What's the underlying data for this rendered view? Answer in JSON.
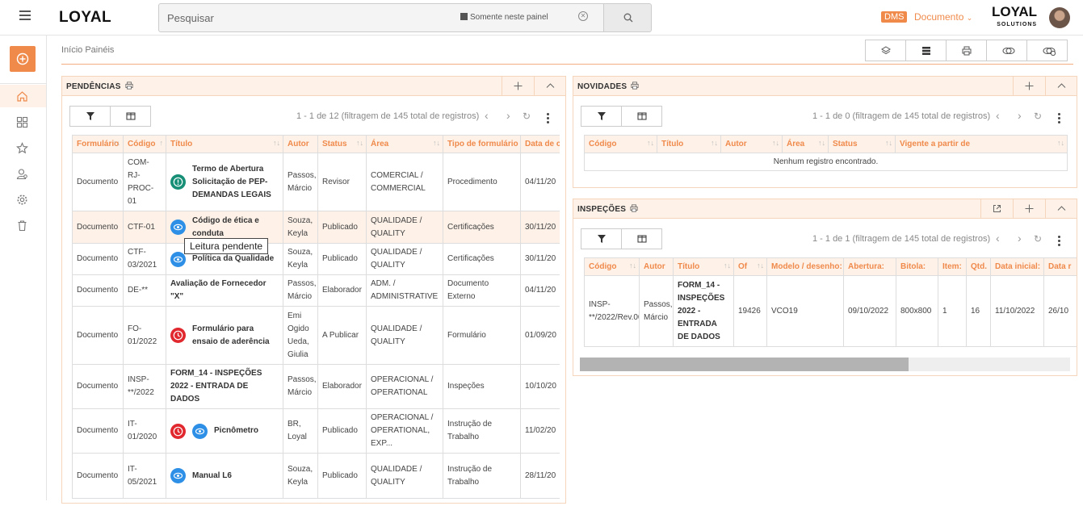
{
  "header": {
    "logo": "LOYAL",
    "search_placeholder": "Pesquisar",
    "only_panel_label": "Somente neste painel",
    "dms_badge": "DMS",
    "module_label": "Documento",
    "brand": "LOYAL",
    "brand_sub": "SOLUTIONS"
  },
  "sidebar": {
    "items": [
      "home-icon",
      "dashboard-grid-icon",
      "star-icon",
      "user-search-icon",
      "gear-icon",
      "trash-icon"
    ]
  },
  "breadcrumb": "Início Painéis",
  "pendencias": {
    "title": "PENDÊNCIAS",
    "paging": "1 - 1 de 12 (filtragem de 145 total de registros)",
    "columns": [
      "Formulário",
      "Código",
      "Título",
      "Autor",
      "Status",
      "Área",
      "Tipo de formulário",
      "Data de cr"
    ],
    "rows": [
      {
        "form": "Documento",
        "code": "COM-RJ-PROC-01",
        "title": "Termo de Abertura Solicitação de PEP-DEMANDAS LEGAIS",
        "author": "Passos, Márcio",
        "status": "Revisor",
        "area": "COMERCIAL / COMMERCIAL",
        "type": "Procedimento",
        "date": "04/11/20"
      },
      {
        "form": "Documento",
        "code": "CTF-01",
        "title": "Código de ética e conduta",
        "author": "Souza, Keyla",
        "status": "Publicado",
        "area": "QUALIDADE / QUALITY",
        "type": "Certificações",
        "date": "30/11/20"
      },
      {
        "form": "Documento",
        "code": "CTF-03/2021",
        "title": "Política da Qualidade",
        "author": "Souza, Keyla",
        "status": "Publicado",
        "area": "QUALIDADE / QUALITY",
        "type": "Certificações",
        "date": "30/11/20"
      },
      {
        "form": "Documento",
        "code": "DE-**",
        "title": "Avaliação de Fornecedor \"X\"",
        "author": "Passos, Márcio",
        "status": "Elaborador",
        "area": "ADM. / ADMINISTRATIVE",
        "type": "Documento Externo",
        "date": "04/11/20"
      },
      {
        "form": "Documento",
        "code": "FO-01/2022",
        "title": "Formulário para ensaio de aderência",
        "author": "Emi Ogido Ueda, Giulia",
        "status": "A Publicar",
        "area": "QUALIDADE / QUALITY",
        "type": "Formulário",
        "date": "01/09/20"
      },
      {
        "form": "Documento",
        "code": "INSP-**/2022",
        "title": "FORM_14 - INSPEÇÕES 2022 - ENTRADA DE DADOS",
        "author": "Passos, Márcio",
        "status": "Elaborador",
        "area": "OPERACIONAL / OPERATIONAL",
        "type": "Inspeções",
        "date": "10/10/20"
      },
      {
        "form": "Documento",
        "code": "IT-01/2020",
        "title": "Picnômetro",
        "author": "BR, Loyal",
        "status": "Publicado",
        "area": "OPERACIONAL / OPERATIONAL, EXP...",
        "type": "Instrução de Trabalho",
        "date": "11/02/20"
      },
      {
        "form": "Documento",
        "code": "IT-05/2021",
        "title": "Manual L6",
        "author": "Souza, Keyla",
        "status": "Publicado",
        "area": "QUALIDADE / QUALITY",
        "type": "Instrução de Trabalho",
        "date": "28/11/20"
      }
    ],
    "tooltip": "Leitura pendente"
  },
  "novidades": {
    "title": "NOVIDADES",
    "paging": "1 - 1 de 0 (filtragem de 145 total de registros)",
    "columns": [
      "Código",
      "Título",
      "Autor",
      "Área",
      "Status",
      "Vigente a partir de"
    ],
    "empty": "Nenhum registro encontrado."
  },
  "inspecoes": {
    "title": "INSPEÇÕES",
    "paging": "1 - 1 de 1 (filtragem de 145 total de registros)",
    "columns": [
      "Código",
      "Autor",
      "Título",
      "Of",
      "Modelo / desenho:",
      "Abertura:",
      "Bitola:",
      "Item:",
      "Qtd.",
      "Data inicial:",
      "Data r"
    ],
    "row": {
      "code": "INSP-**/2022/Rev.00",
      "author": "Passos, Márcio",
      "title": "FORM_14 - INSPEÇÕES 2022 - ENTRADA DE DADOS",
      "of": "19426",
      "model": "VCO19",
      "opening": "09/10/2022",
      "gauge": "800x800",
      "item": "1",
      "qty": "16",
      "start": "11/10/2022",
      "datar": "26/10"
    }
  },
  "colors": {
    "accent": "#f08a4b",
    "panel_bg": "#fdf1e8",
    "green": "#178f77",
    "red": "#e0282e",
    "blue": "#2d8fe6"
  }
}
